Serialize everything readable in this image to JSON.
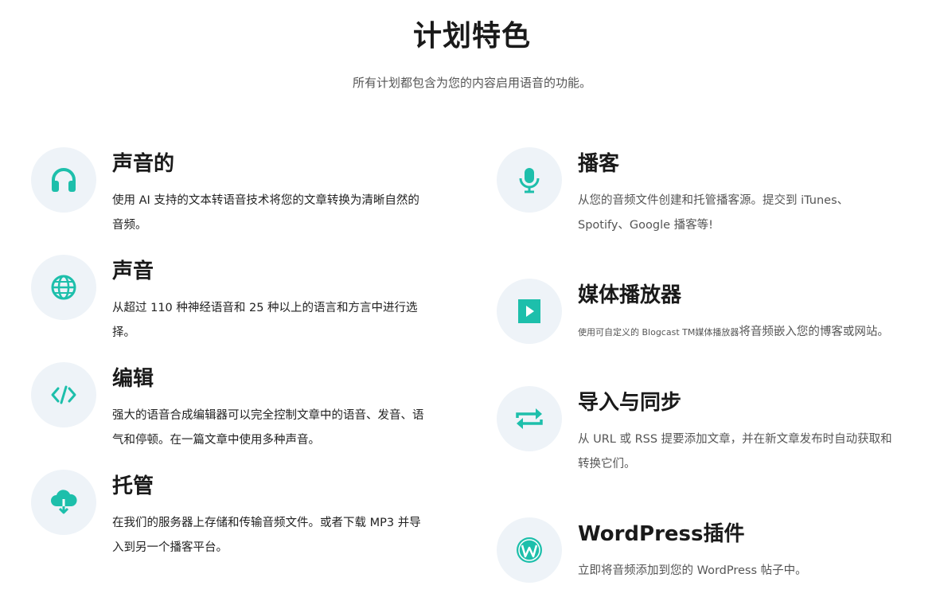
{
  "header": {
    "title": "计划特色",
    "subtitle": "所有计划都包含为您的内容启用语音的功能。"
  },
  "colors": {
    "accent": "#1dbfab",
    "icon_bg": "#eef3f8"
  },
  "features_left": [
    {
      "icon": "headphones-icon",
      "title": "声音的",
      "description": "使用 AI 支持的文本转语音技术将您的文章转换为清晰自然的音频。"
    },
    {
      "icon": "globe-icon",
      "title": "声音",
      "description": "从超过 110 种神经语音和 25 种以上的语言和方言中进行选择。"
    },
    {
      "icon": "code-icon",
      "title": "编辑",
      "description": "强大的语音合成编辑器可以完全控制文章中的语音、发音、语气和停顿。在一篇文章中使用多种声音。"
    },
    {
      "icon": "cloud-download-icon",
      "title": "托管",
      "description": "在我们的服务器上存储和传输音频文件。或者下载 MP3 并导入到另一个播客平台。"
    }
  ],
  "features_right": [
    {
      "icon": "microphone-icon",
      "title": "播客",
      "description": "从您的音频文件创建和托管播客源。提交到 iTunes、Spotify、Google 播客等!"
    },
    {
      "icon": "play-icon",
      "title": "媒体播放器",
      "description_small": "使用可自定义的 Blogcast TM媒体播放器",
      "description": "将音频嵌入您的博客或网站。"
    },
    {
      "icon": "sync-arrows-icon",
      "title": "导入与同步",
      "description": "从 URL 或 RSS 提要添加文章，并在新文章发布时自动获取和转换它们。"
    },
    {
      "icon": "wordpress-icon",
      "title": "WordPress插件",
      "description": "立即将音频添加到您的 WordPress 帖子中。"
    }
  ]
}
